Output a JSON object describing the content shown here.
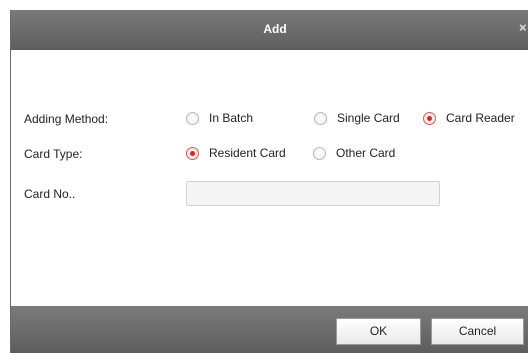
{
  "dialog": {
    "title": "Add",
    "close_glyph": "×"
  },
  "form": {
    "adding_method": {
      "label": "Adding Method:",
      "options": [
        "In Batch",
        "Single Card",
        "Card Reader"
      ],
      "selected": "Card Reader"
    },
    "card_type": {
      "label": "Card Type:",
      "options": [
        "Resident Card",
        "Other Card"
      ],
      "selected": "Resident Card"
    },
    "card_no": {
      "label": "Card No..",
      "value": ""
    }
  },
  "buttons": {
    "ok": "OK",
    "cancel": "Cancel"
  },
  "icons": {
    "close": "close-icon",
    "radio_selected_color": "#d4281e"
  }
}
